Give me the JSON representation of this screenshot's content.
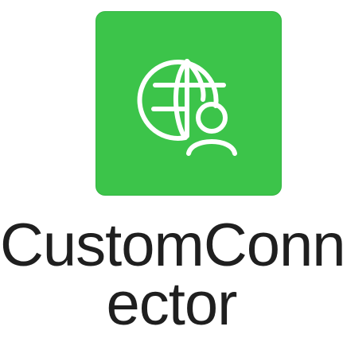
{
  "app": {
    "label_line1": "CustomConn",
    "label_line2": "ector",
    "icon_name": "globe-user-icon",
    "tile_color": "#3cc44a",
    "icon_color": "#ffffff"
  }
}
